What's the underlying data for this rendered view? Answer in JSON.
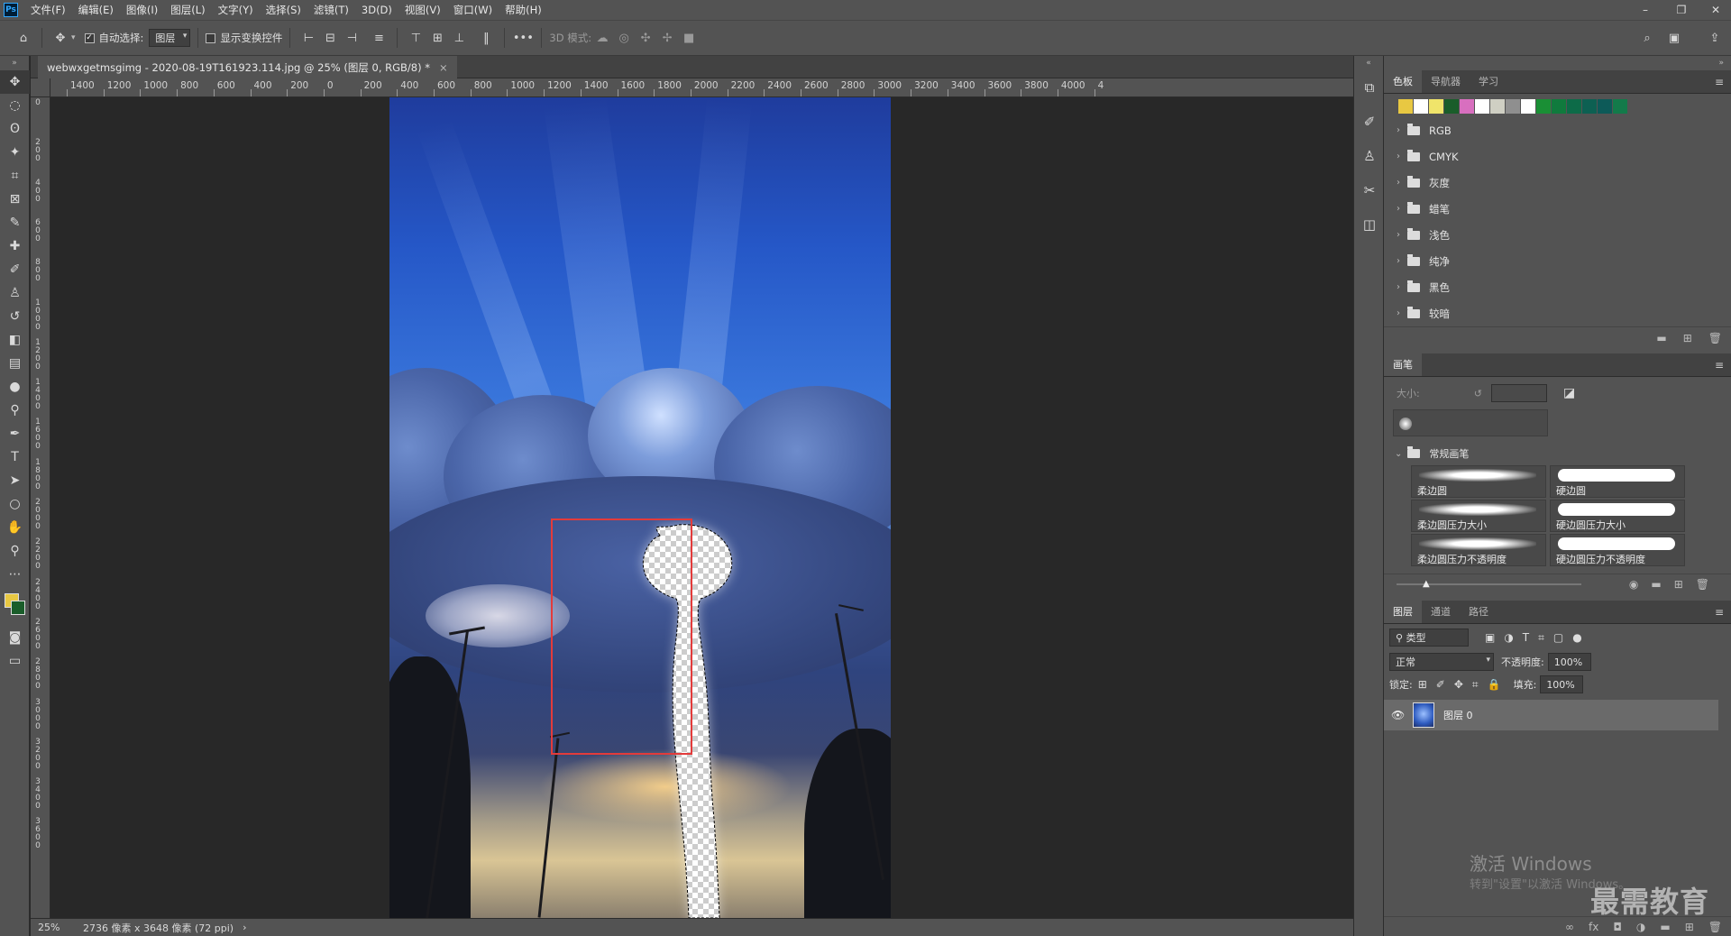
{
  "menu": {
    "logo": "Ps",
    "items": [
      "文件(F)",
      "编辑(E)",
      "图像(I)",
      "图层(L)",
      "文字(Y)",
      "选择(S)",
      "滤镜(T)",
      "3D(D)",
      "视图(V)",
      "窗口(W)",
      "帮助(H)"
    ]
  },
  "window_controls": {
    "minimize": "–",
    "restore": "❐",
    "close": "✕"
  },
  "options": {
    "auto_select_label": "自动选择:",
    "auto_select_checked": true,
    "auto_select_target": "图层",
    "show_transform_label": "显示变换控件",
    "mode_3d_label": "3D 模式:",
    "more": "•••"
  },
  "document": {
    "tab_title": "webwxgetmsgimg - 2020-08-19T161923.114.jpg @ 25% (图层 0, RGB/8) *",
    "close": "×"
  },
  "ruler": {
    "h_labels": [
      "1400",
      "1200",
      "1000",
      "800",
      "600",
      "400",
      "200",
      "0",
      "200",
      "400",
      "600",
      "800",
      "1000",
      "1200",
      "1400",
      "1600",
      "1800",
      "2000",
      "2200",
      "2400",
      "2600",
      "2800",
      "3000",
      "3200",
      "3400",
      "3600",
      "3800",
      "4000",
      "4"
    ],
    "v_labels": [
      "0",
      "200",
      "400",
      "600",
      "800",
      "1000",
      "1200",
      "1400",
      "1600",
      "1800",
      "2000",
      "2200",
      "2400",
      "2600",
      "2800",
      "3000",
      "3200",
      "3400",
      "3600"
    ]
  },
  "status": {
    "zoom": "25%",
    "info": "2736 像素 x 3648 像素 (72 ppi)",
    "arrow": "›"
  },
  "swatches_panel": {
    "tabs": [
      "色板",
      "导航器",
      "学习"
    ],
    "colors": [
      "#e8c842",
      "#ffffff",
      "#f0e46a",
      "#1a5d2a",
      "#d86fbf",
      "#ffffff",
      "#cfcfc3",
      "#8f8f8f",
      "#ffffff",
      "#1a8f35",
      "#107a3d",
      "#0d6b48",
      "#0d6052",
      "#0d5a58",
      "#137a4a"
    ],
    "folders": [
      "RGB",
      "CMYK",
      "灰度",
      "蜡笔",
      "浅色",
      "纯净",
      "黑色",
      "较暗"
    ]
  },
  "brush_panel": {
    "tab": "画笔",
    "size_label": "大小:",
    "group": "常规画笔",
    "brushes": [
      "柔边圆",
      "硬边圆",
      "柔边圆压力大小",
      "硬边圆压力大小",
      "柔边圆压力不透明度",
      "硬边圆压力不透明度"
    ]
  },
  "layers_panel": {
    "tabs": [
      "图层",
      "通道",
      "路径"
    ],
    "filter_label": "类型",
    "blend_mode": "正常",
    "opacity_label": "不透明度:",
    "opacity_value": "100%",
    "lock_label": "锁定:",
    "fill_label": "填充:",
    "fill_value": "100%",
    "layers": [
      {
        "name": "图层 0",
        "visible": true
      }
    ]
  },
  "watermark": {
    "line1": "激活 Windows",
    "line2": "转到\"设置\"以激活 Windows。",
    "brand": "最需教育"
  }
}
